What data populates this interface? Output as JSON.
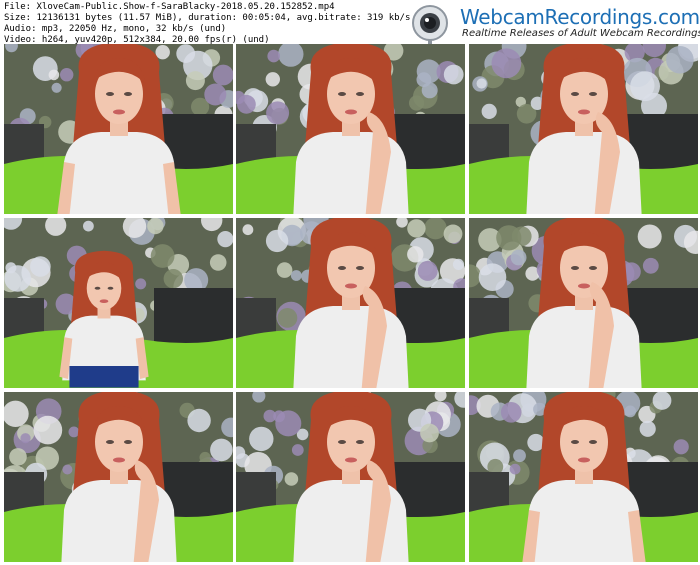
{
  "header": {
    "file_line": "File: XloveCam-Public.Show-f-SaraBlacky-2018.05.20.152852.mp4",
    "size_line": "Size: 12136131 bytes (11.57 MiB), duration: 00:05:04, avg.bitrate: 319 kb/s",
    "audio_line": "Audio: mp3, 22050 Hz, mono, 32 kb/s (und)",
    "video_line": "Video: h264, yuv420p, 512x384, 20.00 fps(r) (und)"
  },
  "logo": {
    "brand": "WebcamRecordings.com",
    "tagline": "Realtime Releases of Adult Webcam Recordings"
  },
  "thumbnails": [
    {
      "pose": "arms-down"
    },
    {
      "pose": "hand-cheek-left"
    },
    {
      "pose": "hand-chin"
    },
    {
      "pose": "far-standing"
    },
    {
      "pose": "hand-chin"
    },
    {
      "pose": "hand-mouth"
    },
    {
      "pose": "hand-cheek-left"
    },
    {
      "pose": "hand-cheek-left"
    },
    {
      "pose": "arms-down"
    }
  ],
  "colors": {
    "brand_blue": "#1d6fb5",
    "hair": "#b2472a",
    "blanket_green": "#7ccf2e",
    "top_white": "#eeeeee"
  }
}
